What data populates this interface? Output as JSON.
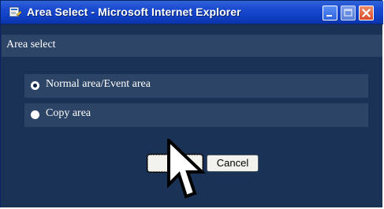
{
  "window": {
    "title": "Area Select - Microsoft Internet Explorer"
  },
  "panel": {
    "header": "Area select"
  },
  "options": [
    {
      "label": "Normal area/Event area",
      "selected": true
    },
    {
      "label": "Copy area",
      "selected": false
    }
  ],
  "buttons": {
    "ok": "OK",
    "cancel": "Cancel"
  },
  "colors": {
    "titlebar_start": "#2f63d8",
    "titlebar_end": "#0c34a8",
    "background": "#1a3255",
    "row_background": "#2c4466",
    "header_background": "#2d4567",
    "text": "#ffffff",
    "button_background": "#f2f2ee",
    "close_button": "#d74b2c"
  },
  "icons": {
    "title_icon": "ie-page-icon",
    "minimize": "minimize-icon",
    "maximize": "maximize-icon",
    "close": "close-icon",
    "cursor": "mouse-pointer-icon"
  }
}
